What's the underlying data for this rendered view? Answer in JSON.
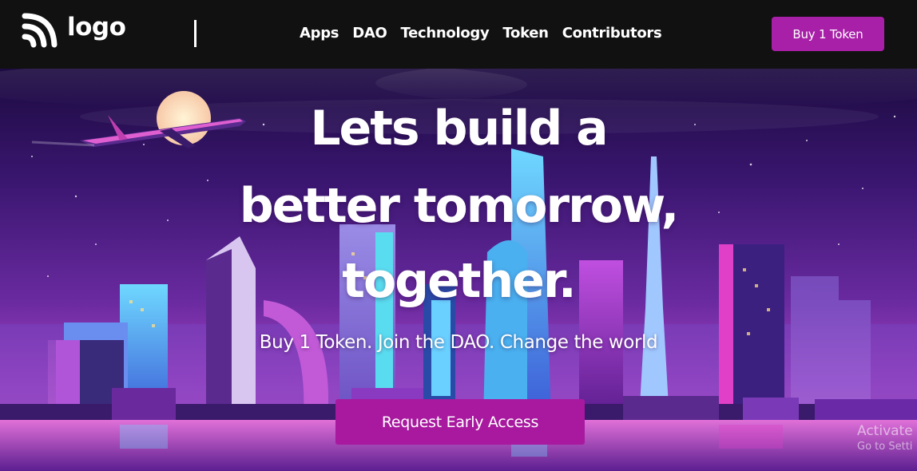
{
  "header": {
    "logo_text": "logo",
    "logo_icon": "wifi-feed-icon",
    "nav": [
      "Apps",
      "DAO",
      "Technology",
      "Token",
      "Contributors"
    ],
    "buy_button": "Buy 1 Token"
  },
  "hero": {
    "headline": [
      "Lets build a",
      "better tomorrow,",
      "together."
    ],
    "subtitle": "Buy 1 Token. Join the DAO. Change the world",
    "cta_button": "Request Early Access",
    "background": "neon-city-skyline-illustration"
  },
  "overlay": {
    "watermark_line1": "Activate",
    "watermark_line2": "Go to Setti"
  },
  "colors": {
    "header_bg": "#111111",
    "accent": "#a81fa8",
    "text": "#ffffff"
  }
}
